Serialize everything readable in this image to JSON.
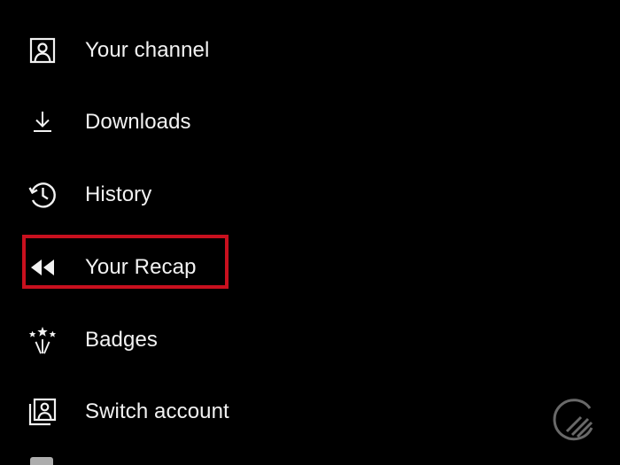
{
  "menu": {
    "items": [
      {
        "label": "Your channel",
        "icon": "person-icon"
      },
      {
        "label": "Downloads",
        "icon": "download-icon"
      },
      {
        "label": "History",
        "icon": "history-icon"
      },
      {
        "label": "Your Recap",
        "icon": "rewind-icon"
      },
      {
        "label": "Badges",
        "icon": "badges-icon"
      },
      {
        "label": "Switch account",
        "icon": "switch-account-icon"
      }
    ]
  },
  "highlight": {
    "target": "Your Recap",
    "color": "#c8101e"
  },
  "colors": {
    "background": "#000000",
    "text": "#f2f2f2",
    "icon": "#f2f2f2"
  },
  "watermark": {
    "icon": "watermark-logo"
  }
}
